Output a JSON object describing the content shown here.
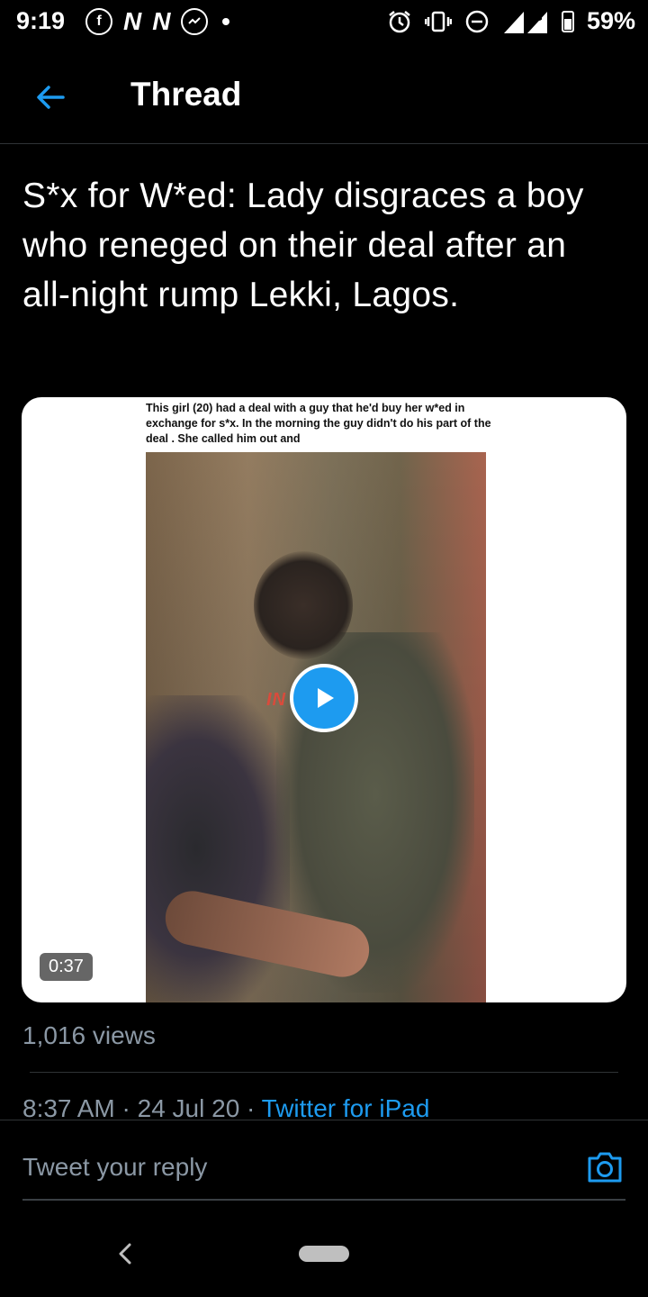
{
  "status_bar": {
    "time": "9:19",
    "battery": "59%",
    "network": "3G",
    "notification_icons": [
      "facebook-icon",
      "n-icon",
      "n-icon",
      "messenger-icon",
      "dot-icon"
    ],
    "system_icons": [
      "alarm-icon",
      "vibrate-icon",
      "dnd-icon",
      "signal-icon",
      "battery-icon"
    ]
  },
  "header": {
    "title": "Thread",
    "accent": "#1d9bf0"
  },
  "tweet": {
    "text": "S*x for W*ed: Lady disgraces a boy who reneged on their deal after an all-night rump Lekki, Lagos.",
    "media": {
      "caption": "This girl (20) had a deal with a guy that he'd buy her w*ed in exchange for s*x. In the morning the guy didn't do his part of the deal . She called him out and",
      "watermark": "IN G9JA",
      "duration": "0:37"
    },
    "views": "1,016 views",
    "time": "8:37 AM",
    "date": "24 Jul 20",
    "separator": "·",
    "source": "Twitter for iPad"
  },
  "reply": {
    "placeholder": "Tweet your reply"
  }
}
